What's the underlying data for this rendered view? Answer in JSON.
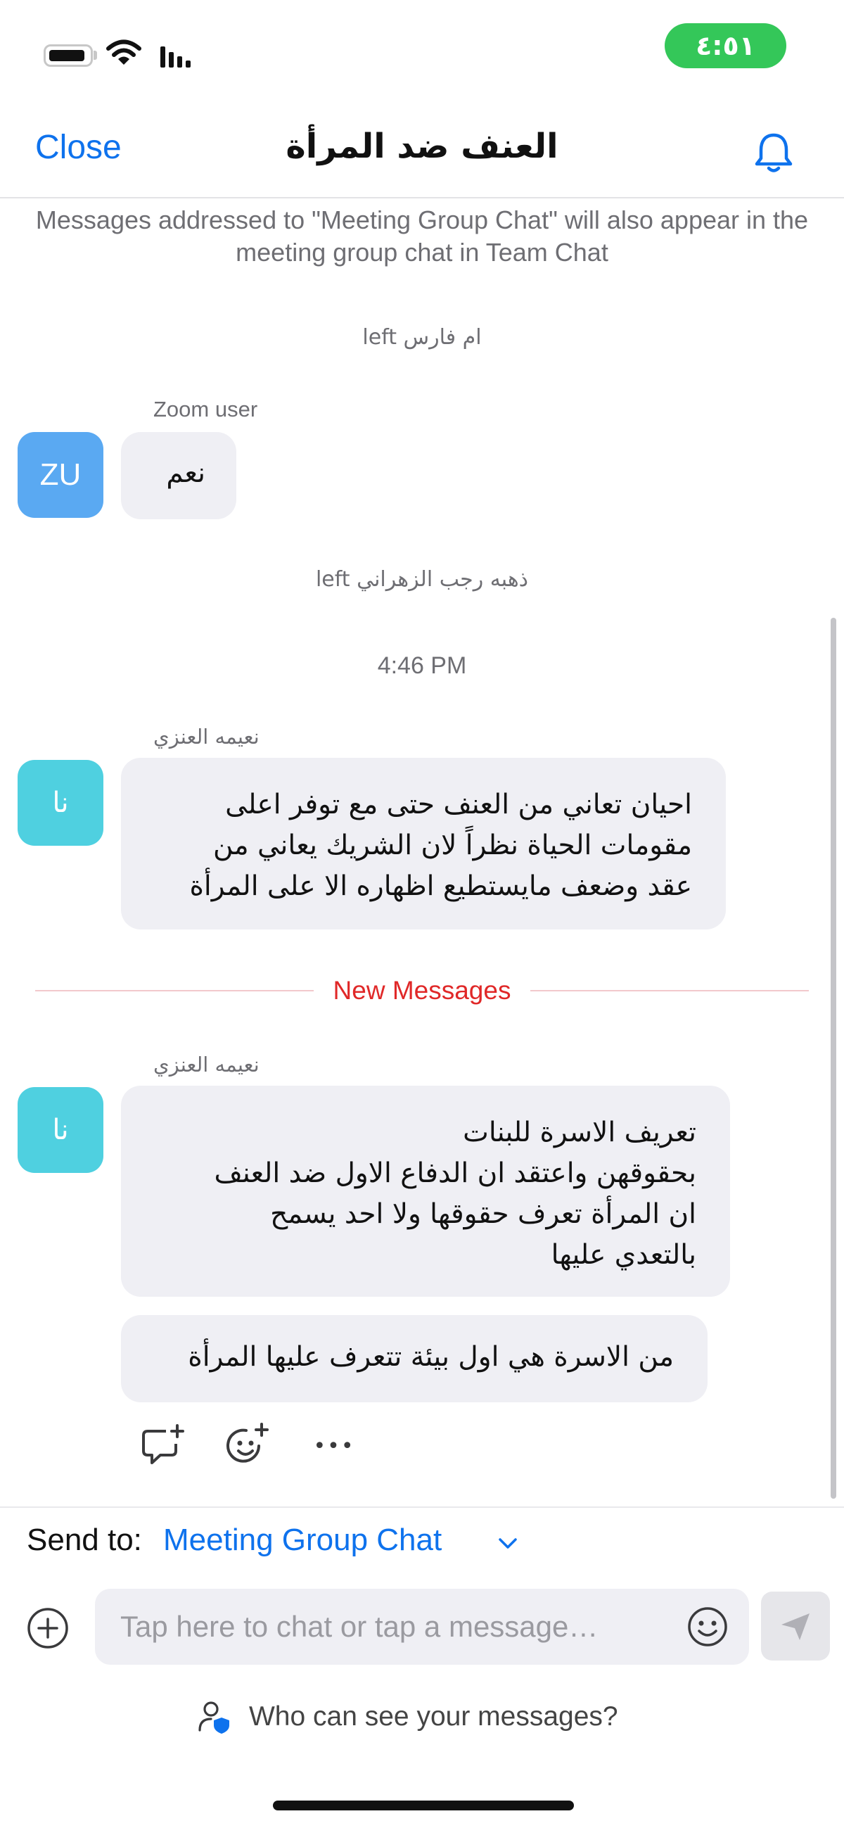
{
  "status_bar": {
    "time": "٤:٥١",
    "time_pill_color": "#34c759",
    "icons": [
      "battery-icon",
      "wifi-icon",
      "cellular-signal-icon"
    ]
  },
  "header": {
    "close_label": "Close",
    "title": "العنف ضد المرأة",
    "bell_icon": "bell-icon"
  },
  "chat": {
    "notice": "Messages addressed to \"Meeting Group Chat\" will also appear in the meeting group chat in Team Chat",
    "system_1": "ام فارس left",
    "message_1": {
      "sender": "Zoom user",
      "avatar": "ZU",
      "text": "نعم"
    },
    "system_2": "ذهبه رجب الزهراني left",
    "time_divider": "4:46 PM",
    "message_2": {
      "sender": "نعيمه العنزي",
      "avatar": "نا",
      "lines": [
        "احيان تعاني من العنف حتى مع توفر اعلى",
        "مقومات الحياة نظراً لان الشريك يعاني من",
        "عقد وضعف مايستطيع اظهاره الا على المرأة"
      ]
    },
    "new_messages_label": "New Messages",
    "new_messages_color": "#e02828",
    "message_3": {
      "sender": "نعيمه العنزي",
      "avatar": "نا",
      "lines": [
        "تعريف الاسرة للبنات",
        "بحقوقهن واعتقد ان الدفاع الاول ضد العنف",
        "ان المرأة تعرف حقوقها ولا احد يسمح",
        "بالتعدي عليها"
      ],
      "followup": "من الاسرة هي اول بيئة تتعرف عليها المرأة"
    },
    "actions": {
      "reply_icon": "reply-comment-icon",
      "reaction_icon": "add-reaction-icon",
      "more_icon": "more-dots-icon",
      "more_label": "•••"
    }
  },
  "composer": {
    "send_to_label": "Send to:",
    "send_to_target": "Meeting Group Chat",
    "input_placeholder": "Tap here to chat or tap a message…",
    "input_value": "",
    "who_can_see": "Who can see your messages?",
    "accent_color": "#0e72ed"
  }
}
